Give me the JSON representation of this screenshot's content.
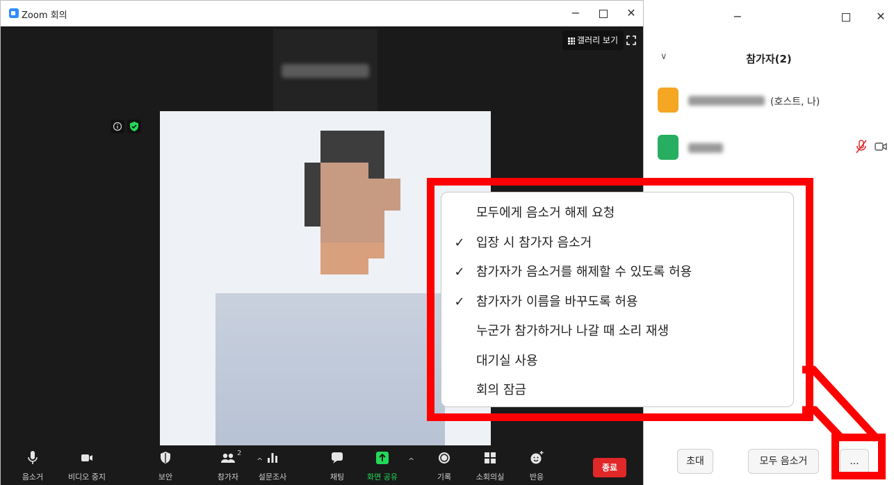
{
  "zoom_window": {
    "title": "Zoom 회의",
    "gallery_view_label": "갤러리 보기"
  },
  "toolbar": {
    "mute": "음소거",
    "stop_video": "비디오 중지",
    "security": "보안",
    "participants": "참가자",
    "participants_count": "2",
    "polls": "설문조사",
    "chat": "채팅",
    "share_screen": "화면 공유",
    "record": "기록",
    "breakout_rooms": "소회의실",
    "reactions": "반응",
    "end": "종료"
  },
  "panel": {
    "title": "참가자(2)",
    "participants": [
      {
        "suffix": "(호스트, 나)",
        "avatar_color": "#f5a623"
      },
      {
        "suffix": "",
        "avatar_color": "#27ae60"
      }
    ],
    "invite_button": "초대",
    "mute_all_button": "모두 음소거",
    "more_button": "..."
  },
  "more_menu": {
    "items": [
      {
        "label": "모두에게 음소거 해제 요청",
        "checked": false
      },
      {
        "label": "입장 시 참가자 음소거",
        "checked": true
      },
      {
        "label": "참가자가 음소거를 해제할 수 있도록 허용",
        "checked": true
      },
      {
        "label": "참가자가 이름을 바꾸도록 허용",
        "checked": true
      },
      {
        "label": "누군가 참가하거나 나갈 때 소리 재생",
        "checked": false
      },
      {
        "label": "대기실 사용",
        "checked": false
      },
      {
        "label": "회의 잠금",
        "checked": false
      }
    ],
    "check_glyph": "✓"
  },
  "colors": {
    "highlight": "#ff0000",
    "share_green": "#23d959",
    "end_red": "#e02828"
  }
}
